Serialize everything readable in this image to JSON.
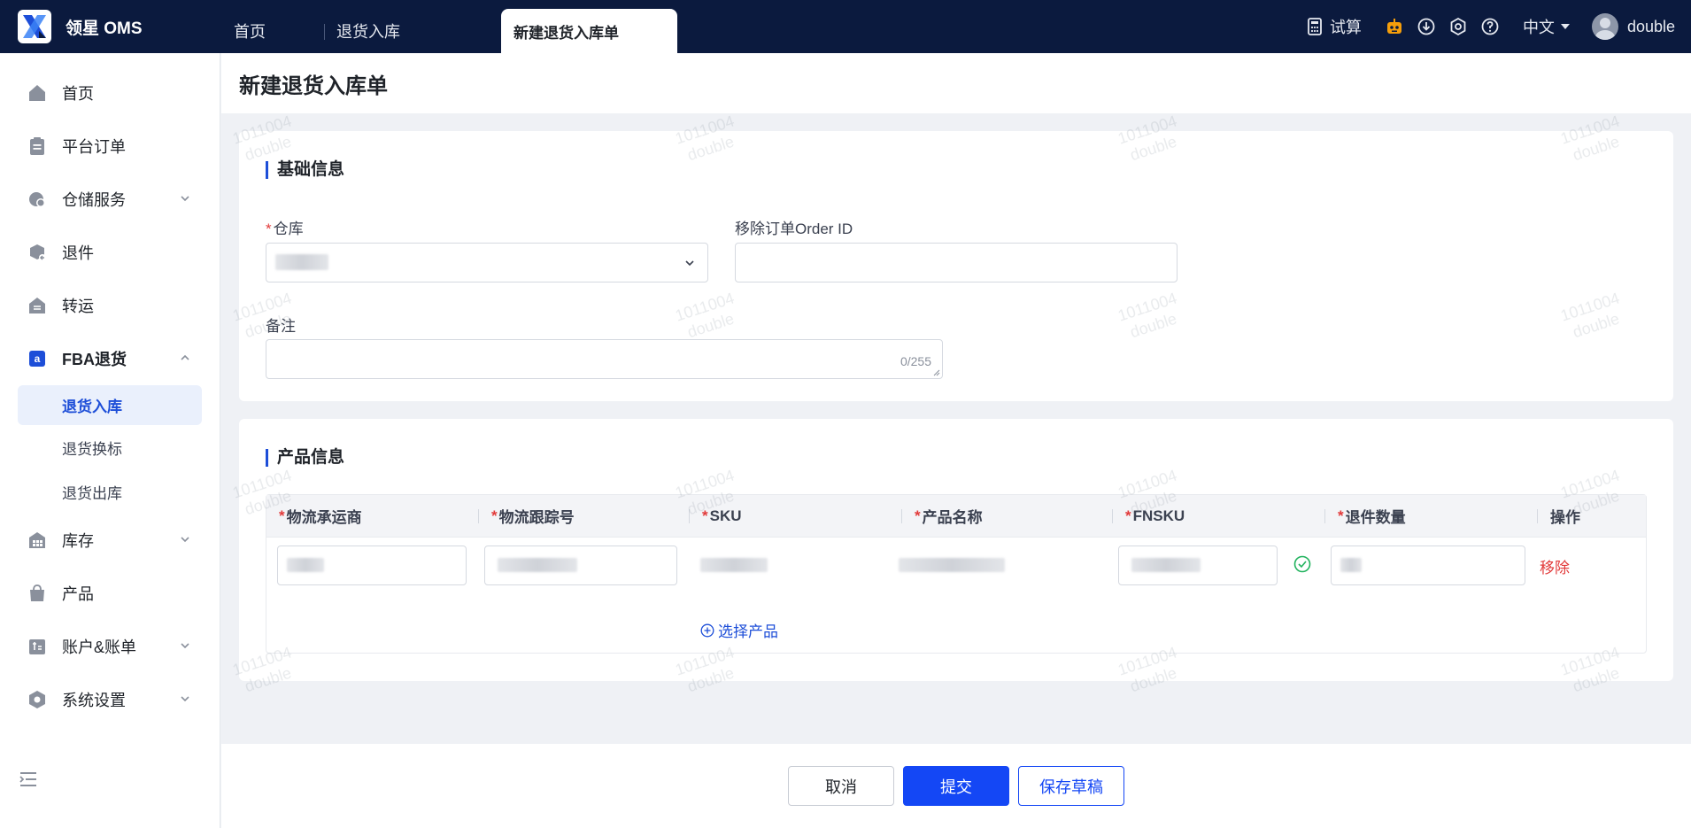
{
  "app": {
    "logo_text": "领星 OMS"
  },
  "tabs": [
    {
      "label": "首页"
    },
    {
      "label": "退货入库"
    },
    {
      "label": "新建退货入库单"
    }
  ],
  "header_right": {
    "calculator_label": "试算",
    "language": "中文",
    "username": "double"
  },
  "sidebar": {
    "items": [
      {
        "label": "首页",
        "icon": "home-icon"
      },
      {
        "label": "平台订单",
        "icon": "clipboard-icon"
      },
      {
        "label": "仓储服务",
        "icon": "warehouse-service-icon"
      },
      {
        "label": "退件",
        "icon": "return-box-icon"
      },
      {
        "label": "转运",
        "icon": "transfer-icon"
      },
      {
        "label": "FBA退货",
        "icon": "amazon-icon"
      },
      {
        "label": "库存",
        "icon": "inventory-icon"
      },
      {
        "label": "产品",
        "icon": "product-bag-icon"
      },
      {
        "label": "账户&账单",
        "icon": "bill-icon"
      },
      {
        "label": "系统设置",
        "icon": "settings-hex-icon"
      }
    ],
    "fba_sub": [
      {
        "label": "退货入库"
      },
      {
        "label": "退货换标"
      },
      {
        "label": "退货出库"
      }
    ]
  },
  "page": {
    "title": "新建退货入库单"
  },
  "basic_info": {
    "title": "基础信息",
    "warehouse_label": "仓库",
    "removal_order_label": "移除订单Order ID",
    "remark_label": "备注",
    "remark_counter": "0/255"
  },
  "product_info": {
    "title": "产品信息",
    "columns": [
      "物流承运商",
      "物流跟踪号",
      "SKU",
      "产品名称",
      "FNSKU",
      "退件数量",
      "操作"
    ],
    "remove_label": "移除",
    "select_product_label": "选择产品"
  },
  "footer": {
    "cancel": "取消",
    "submit": "提交",
    "save_draft": "保存草稿"
  },
  "watermark": {
    "line1": "1011004",
    "line2": "double"
  },
  "colors": {
    "topbar": "#0b1a3e",
    "primary": "#1447f5",
    "danger": "#e23a3a",
    "active_menu_bg": "#eaf0fc"
  }
}
